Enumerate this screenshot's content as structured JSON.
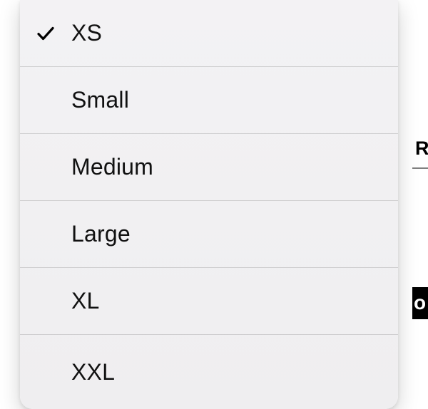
{
  "menu": {
    "selected_index": 0,
    "items": [
      {
        "label": "XS"
      },
      {
        "label": "Small"
      },
      {
        "label": "Medium"
      },
      {
        "label": "Large"
      },
      {
        "label": "XL"
      },
      {
        "label": "XXL"
      }
    ]
  },
  "background": {
    "right_letter": "R",
    "right_box_letter": "o"
  }
}
